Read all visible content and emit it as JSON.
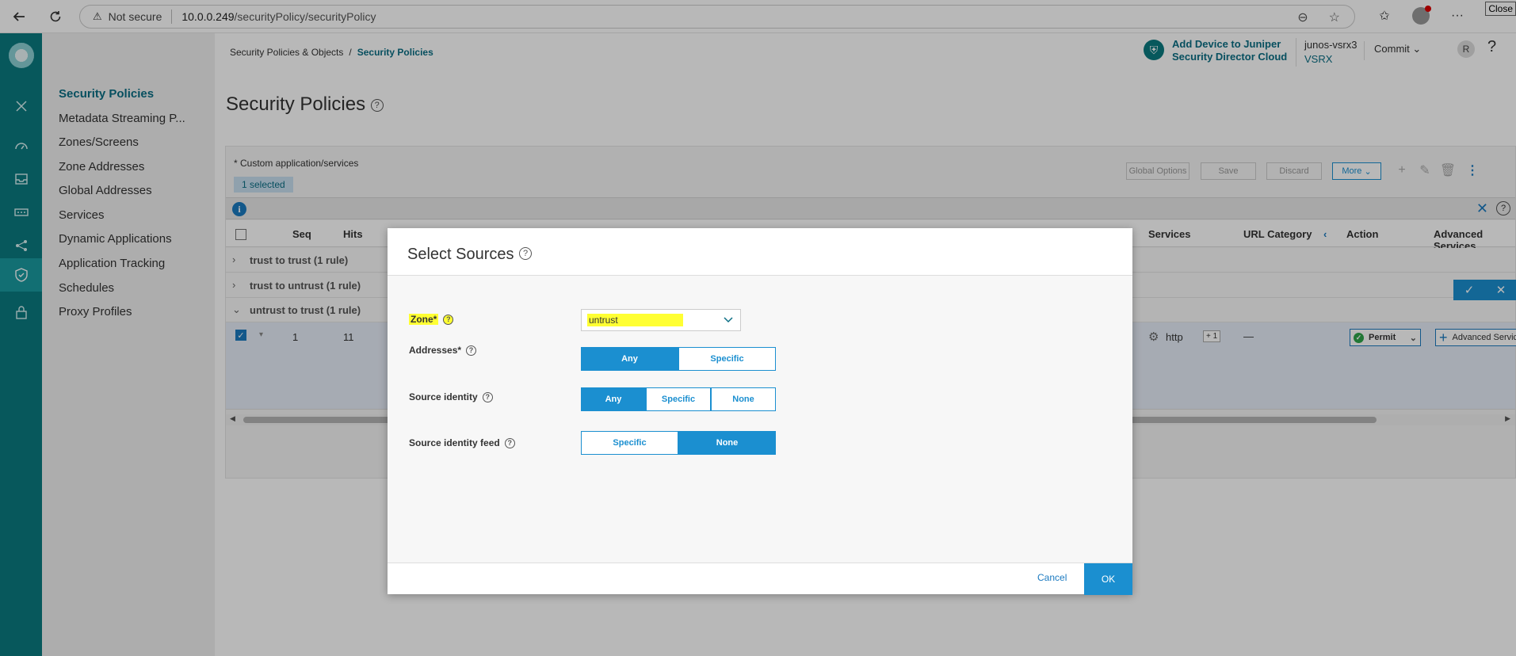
{
  "browser": {
    "security_label": "Not secure",
    "url_host": "10.0.0.249",
    "url_path": "/securityPolicy/securityPolicy",
    "close_tooltip": "Close"
  },
  "subnav": {
    "items": [
      {
        "label": "Security Policies"
      },
      {
        "label": "Metadata Streaming P..."
      },
      {
        "label": "Zones/Screens"
      },
      {
        "label": "Zone Addresses"
      },
      {
        "label": "Global Addresses"
      },
      {
        "label": "Services"
      },
      {
        "label": "Dynamic Applications"
      },
      {
        "label": "Application Tracking"
      },
      {
        "label": "Schedules"
      },
      {
        "label": "Proxy Profiles"
      }
    ]
  },
  "breadcrumb": {
    "parent": "Security Policies & Objects",
    "separator": "/",
    "current": "Security Policies"
  },
  "page": {
    "title": "Security Policies",
    "help_glyph": "?"
  },
  "topbar": {
    "sd_line1": "Add Device to Juniper",
    "sd_line2": "Security Director Cloud",
    "device_name": "junos-vsrx3",
    "device_type": "VSRX",
    "commit_label": "Commit",
    "user_initial": "R",
    "help": "?"
  },
  "panel": {
    "note": "* Custom application/services",
    "selected_badge": "1 selected",
    "toolbar": {
      "global_options": "Global Options",
      "save": "Save",
      "discard": "Discard",
      "more": "More"
    }
  },
  "table": {
    "headers": {
      "seq": "Seq",
      "hits": "Hits",
      "services": "Services",
      "url_category": "URL Category",
      "action": "Action",
      "advanced_services": "Advanced Services"
    },
    "groups": [
      {
        "label": "trust to trust (1 rule)"
      },
      {
        "label": "trust to untrust (1 rule)"
      },
      {
        "label": "untrust to trust (1 rule)"
      }
    ],
    "row": {
      "seq": "1",
      "hits": "11",
      "service": "http",
      "service_more": "+ 1",
      "url_category": "—",
      "action": "Permit",
      "advanced": "Advanced Services"
    }
  },
  "modal": {
    "title": "Select Sources",
    "zone_label": "Zone*",
    "zone_value": "untrust",
    "addresses_label": "Addresses*",
    "addresses_options": [
      "Any",
      "Specific"
    ],
    "addresses_selected": "Any",
    "identity_label": "Source identity",
    "identity_options": [
      "Any",
      "Specific",
      "None"
    ],
    "identity_selected": "Any",
    "identity_feed_label": "Source identity feed",
    "identity_feed_options": [
      "Specific",
      "None"
    ],
    "identity_feed_selected": "None",
    "cancel": "Cancel",
    "ok": "OK"
  }
}
